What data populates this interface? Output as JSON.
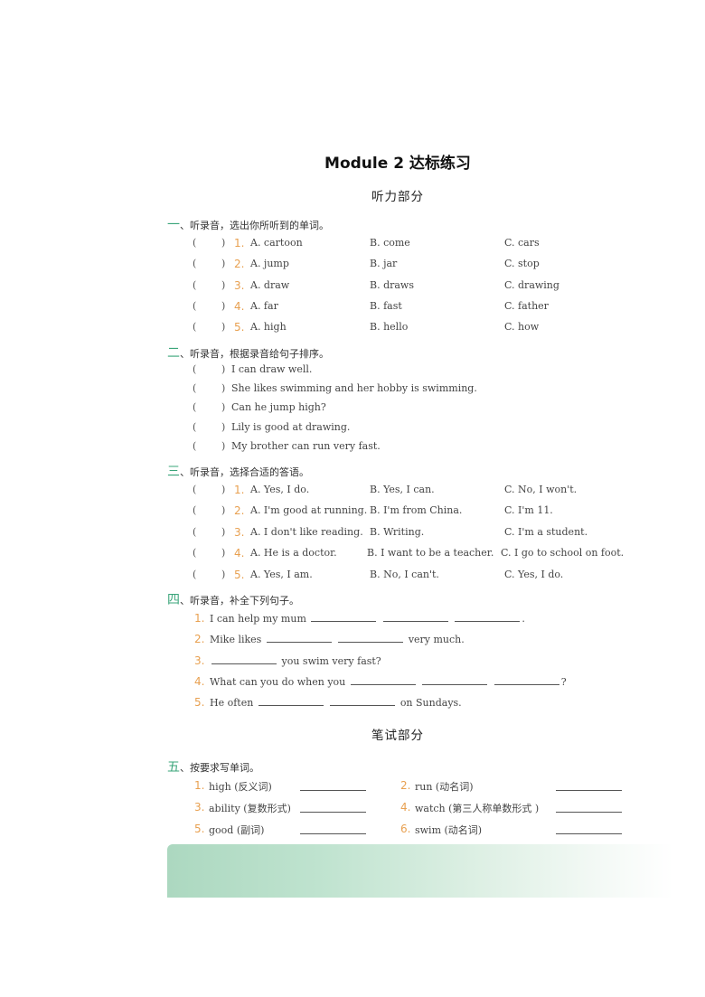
{
  "title": "Module 2 达标练习",
  "listening_heading": "听力部分",
  "writing_heading": "笔试部分",
  "colors": {
    "section_number": "#3aa57a",
    "question_number": "#e8a050",
    "footer_band_start": "#acd8c0"
  },
  "paren_left": "(",
  "paren_right": ")",
  "section1": {
    "num": "一",
    "instruction": "、听录音，选出你所听到的单词。",
    "items": [
      {
        "n": "1.",
        "a": "A. cartoon",
        "b": "B. come",
        "c": "C. cars"
      },
      {
        "n": "2.",
        "a": "A. jump",
        "b": "B. jar",
        "c": "C. stop"
      },
      {
        "n": "3.",
        "a": "A. draw",
        "b": "B. draws",
        "c": "C. drawing"
      },
      {
        "n": "4.",
        "a": "A. far",
        "b": "B. fast",
        "c": "C. father"
      },
      {
        "n": "5.",
        "a": "A. high",
        "b": "B. hello",
        "c": "C. how"
      }
    ]
  },
  "section2": {
    "num": "二",
    "instruction": "、听录音，根据录音给句子排序。",
    "items": [
      "I can draw well.",
      "She likes swimming and her hobby is swimming.",
      "Can he jump high?",
      "Lily is good at drawing.",
      "My brother can run very fast."
    ]
  },
  "section3": {
    "num": "三",
    "instruction": "、听录音，选择合适的答语。",
    "items": [
      {
        "n": "1.",
        "a": "A. Yes, I do.",
        "b": "B. Yes, I can.",
        "c": "C. No, I won't."
      },
      {
        "n": "2.",
        "a": "A. I'm good at running.",
        "b": "B. I'm from China.",
        "c": "C. I'm 11."
      },
      {
        "n": "3.",
        "a": "A. I don't like reading.",
        "b": "B. Writing.",
        "c": "C. I'm a student."
      },
      {
        "n": "4.",
        "a": "A. He is a doctor.",
        "b": "B. I want to be a teacher.",
        "c": "C. I go to school on foot."
      },
      {
        "n": "5.",
        "a": "A. Yes, I am.",
        "b": "B. No, I can't.",
        "c": "C. Yes, I do."
      }
    ]
  },
  "section4": {
    "num": "四",
    "instruction": "、听录音，补全下列句子。",
    "items": [
      {
        "n": "1.",
        "before": "I can help my mum",
        "blanks": 3,
        "after": "."
      },
      {
        "n": "2.",
        "before": "Mike likes",
        "blanks": 2,
        "after": "very much."
      },
      {
        "n": "3.",
        "before": "",
        "blanks": 1,
        "after": "you swim very fast?"
      },
      {
        "n": "4.",
        "before": "What can you do when you",
        "blanks": 3,
        "after": "?"
      },
      {
        "n": "5.",
        "before": "He often",
        "blanks": 2,
        "after": "on Sundays."
      }
    ]
  },
  "section5": {
    "num": "五",
    "instruction": "、按要求写单词。",
    "items": [
      {
        "n": "1.",
        "text": "high (反义词)"
      },
      {
        "n": "2.",
        "text": "run (动名词)"
      },
      {
        "n": "3.",
        "text": "ability (复数形式)"
      },
      {
        "n": "4.",
        "text": "watch (第三人称单数形式 )"
      },
      {
        "n": "5.",
        "text": "good (副词)"
      },
      {
        "n": "6.",
        "text": "swim (动名词)"
      }
    ]
  }
}
